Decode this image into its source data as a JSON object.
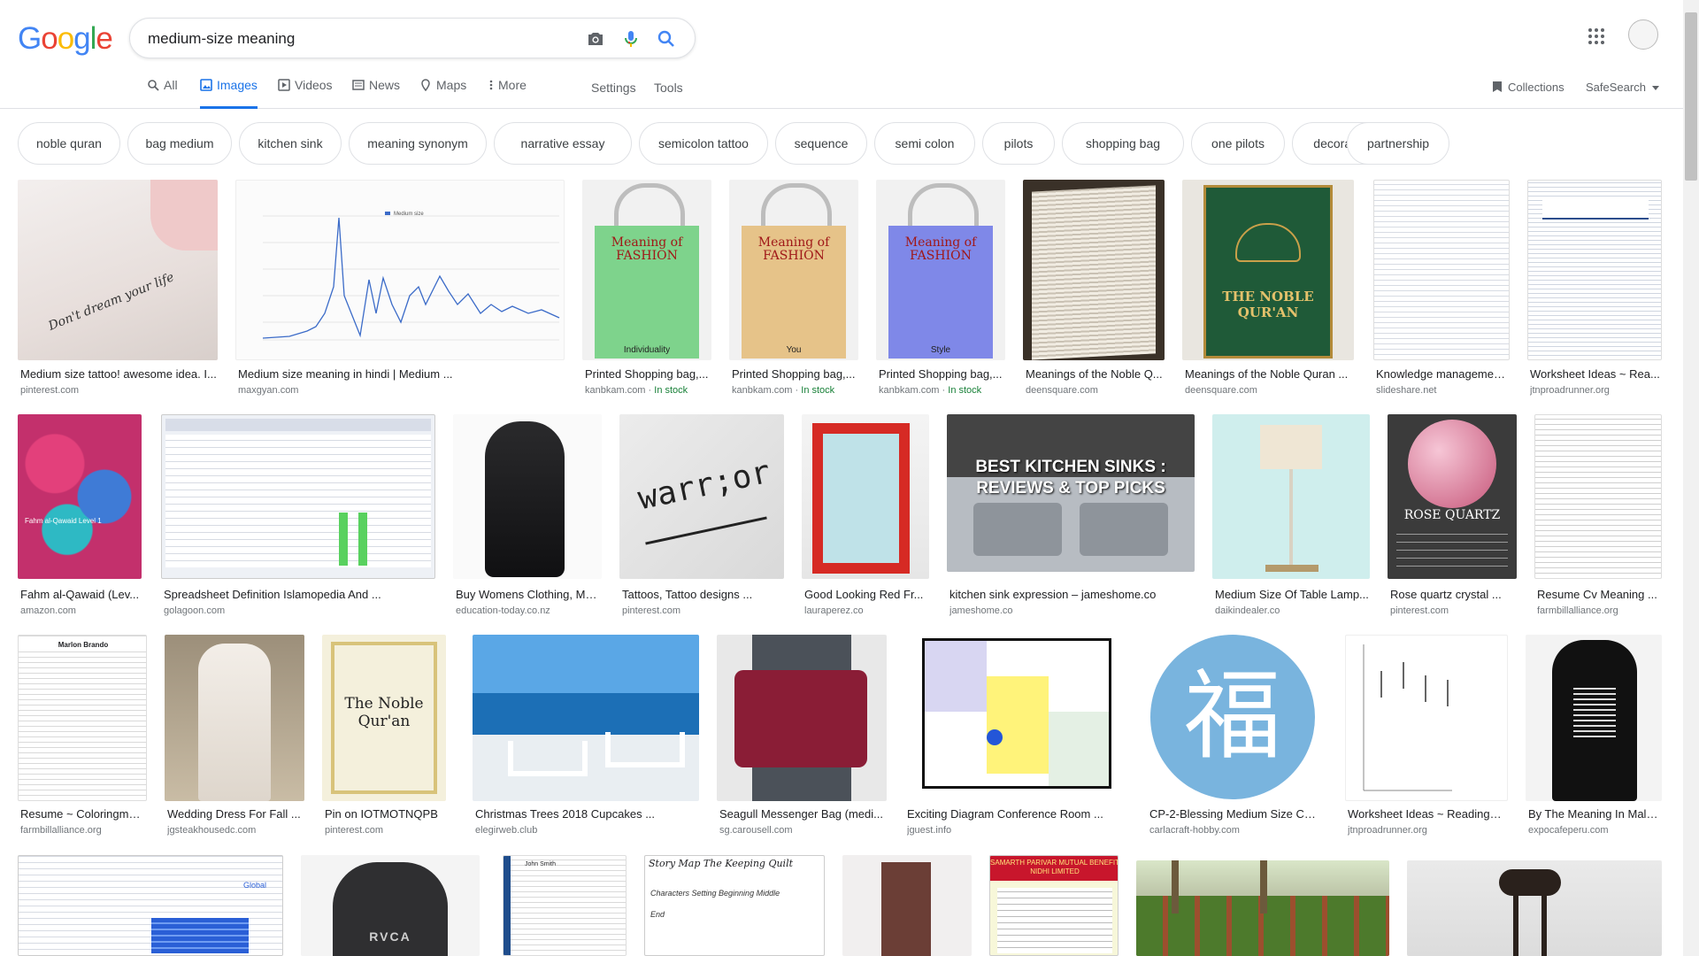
{
  "logo": [
    "G",
    "o",
    "o",
    "g",
    "l",
    "e"
  ],
  "logo_colors": [
    "#4285F4",
    "#EA4335",
    "#FBBC05",
    "#4285F4",
    "#34A853",
    "#EA4335"
  ],
  "search": {
    "query": "medium-size meaning"
  },
  "tabs": [
    {
      "label": "All",
      "icon": "search-icon"
    },
    {
      "label": "Images",
      "icon": "image-icon",
      "active": true
    },
    {
      "label": "Videos",
      "icon": "play-icon"
    },
    {
      "label": "News",
      "icon": "news-icon"
    },
    {
      "label": "Maps",
      "icon": "map-pin-icon"
    },
    {
      "label": "More",
      "icon": "kebab-icon"
    }
  ],
  "settings": "Settings",
  "tools": "Tools",
  "collections": "Collections",
  "safesearch": "SafeSearch",
  "chips": [
    "noble quran",
    "bag medium",
    "kitchen sink",
    "meaning synonym",
    "narrative essay",
    "semicolon tattoo",
    "sequence",
    "semi colon",
    "pilots",
    "shopping bag",
    "one pilots",
    "decorating",
    "partnership"
  ],
  "row1": [
    {
      "caption": "Medium size tattoo! awesome idea. I...",
      "source": "pinterest.com",
      "stock": "",
      "thumb_text": "Don't dream your life"
    },
    {
      "caption": "Medium size meaning in hindi | Medium ...",
      "source": "maxgyan.com",
      "stock": "",
      "thumb_text": "Medium size"
    },
    {
      "caption": "Printed Shopping bag,...",
      "source": "kanbkam.com",
      "stock": "In stock",
      "thumb_text": "Meaning of FASHION",
      "thumb_sub": "Individuality"
    },
    {
      "caption": "Printed Shopping bag,...",
      "source": "kanbkam.com",
      "stock": "In stock",
      "thumb_text": "Meaning of FASHION",
      "thumb_sub": "You"
    },
    {
      "caption": "Printed Shopping bag,...",
      "source": "kanbkam.com",
      "stock": "In stock",
      "thumb_text": "Meaning of FASHION",
      "thumb_sub": "Style"
    },
    {
      "caption": "Meanings of the Noble Q...",
      "source": "deensquare.com",
      "stock": ""
    },
    {
      "caption": "Meanings of the Noble Quran ...",
      "source": "deensquare.com",
      "stock": "",
      "thumb_text": "THE NOBLE QUR'AN"
    },
    {
      "caption": "Knowledge managemen...",
      "source": "slideshare.net",
      "stock": ""
    },
    {
      "caption": "Worksheet Ideas ~ Rea...",
      "source": "jtnproadrunner.org",
      "stock": ""
    }
  ],
  "row2": [
    {
      "caption": "Fahm al-Qawaid (Lev...",
      "source": "amazon.com",
      "thumb_text": "Fahm al-Qawaid Level 1"
    },
    {
      "caption": "Spreadsheet Definition Islamopedia And ...",
      "source": "golagoon.com"
    },
    {
      "caption": "Buy Womens Clothing, Me...",
      "source": "education-today.co.nz"
    },
    {
      "caption": "Tattoos, Tattoo designs ...",
      "source": "pinterest.com",
      "thumb_text": "warr;or"
    },
    {
      "caption": "Good Looking Red Fr...",
      "source": "lauraperez.co"
    },
    {
      "caption": "kitchen sink expression – jameshome.co",
      "source": "jameshome.co",
      "thumb_text": "BEST KITCHEN SINKS : REVIEWS & TOP PICKS"
    },
    {
      "caption": "Medium Size Of Table Lamp...",
      "source": "daikindealer.co"
    },
    {
      "caption": "Rose quartz crystal ...",
      "source": "pinterest.com",
      "thumb_text": "ROSE QUARTZ"
    },
    {
      "caption": "Resume Cv Meaning ...",
      "source": "farmbillalliance.org"
    }
  ],
  "row3": [
    {
      "caption": "Resume ~ Coloringme ...",
      "source": "farmbillalliance.org",
      "thumb_text": "Marlon Brando"
    },
    {
      "caption": "Wedding Dress For Fall ...",
      "source": "jgsteakhousedc.com"
    },
    {
      "caption": "Pin on IOTMOTNQPB",
      "source": "pinterest.com",
      "thumb_text": "The Noble Qur'an"
    },
    {
      "caption": "Christmas Trees 2018 Cupcakes ...",
      "source": "elegirweb.club"
    },
    {
      "caption": "Seagull Messenger Bag (medi...",
      "source": "sg.carousell.com"
    },
    {
      "caption": "Exciting Diagram Conference Room ...",
      "source": "jguest.info"
    },
    {
      "caption": "CP-2-Blessing Medium Size Craf...",
      "source": "carlacraft-hobby.com",
      "thumb_text": "福"
    },
    {
      "caption": "Worksheet Ideas ~ Readingm...",
      "source": "jtnproadrunner.org"
    },
    {
      "caption": "By The Meaning In Mala...",
      "source": "expocafeperu.com"
    }
  ],
  "row4": [
    {
      "thumb_text": "Global"
    },
    {
      "thumb_text": "RVCA"
    },
    {
      "thumb_text": "John Smith"
    },
    {
      "thumb_text": "Story Map  The Keeping Quilt",
      "thumb_sub": "Characters  Setting  Beginning  Middle  End"
    },
    {
      "thumb_text": ""
    },
    {
      "thumb_text": "SAMARTH PARIVAR MUTUAL BENEFIT NIDHI LIMITED"
    },
    {
      "thumb_text": ""
    },
    {
      "thumb_text": ""
    }
  ]
}
